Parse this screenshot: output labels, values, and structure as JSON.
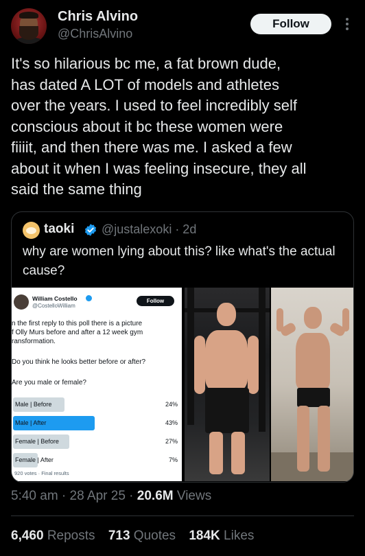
{
  "author": {
    "name": "Chris Alvino",
    "handle": "@ChrisAlvino",
    "follow_label": "Follow"
  },
  "tweet": {
    "text": "It's so hilarious bc me, a fat brown dude,\nhas dated A LOT of models and athletes\nover the years. I used to feel incredibly self\nconscious about it bc these women were\nfiiiit, and then there was me. I asked a few\nabout it when I was feeling insecure, they all\nsaid the same thing"
  },
  "quote": {
    "name": "taoki",
    "handle_time": "@justalexoki · 2d",
    "text": "why are women lying about this? like what's the actual cause?",
    "media": {
      "poll_screenshot": {
        "name": "William Costello",
        "handle": "@CostelloWilliam",
        "follow_label": "Follow",
        "para1": "n the first reply to this poll there is a picture\nf Olly Murs before and after a 12 week gym\nransformation.",
        "para2": "Do you think he looks better before or after?",
        "para3": "Are you male or female?",
        "options": [
          {
            "label": "Male | Before",
            "pct": "24%",
            "value": 24
          },
          {
            "label": "Male | After",
            "pct": "43%",
            "value": 43
          },
          {
            "label": "Female | Before",
            "pct": "27%",
            "value": 27
          },
          {
            "label": "Female | After",
            "pct": "7%",
            "value": 7
          }
        ],
        "footer": "920 votes · Final results"
      }
    }
  },
  "meta": {
    "time": "5:40 am",
    "date": "28 Apr 25",
    "views_count": "20.6M",
    "views_label": "Views"
  },
  "stats": {
    "reposts_count": "6,460",
    "reposts_label": "Reposts",
    "quotes_count": "713",
    "quotes_label": "Quotes",
    "likes_count": "184K",
    "likes_label": "Likes"
  },
  "colors": {
    "background": "#000000",
    "text": "#e7e9ea",
    "secondary": "#71767b",
    "verified": "#1d9bf0",
    "divider": "#2f3336"
  }
}
